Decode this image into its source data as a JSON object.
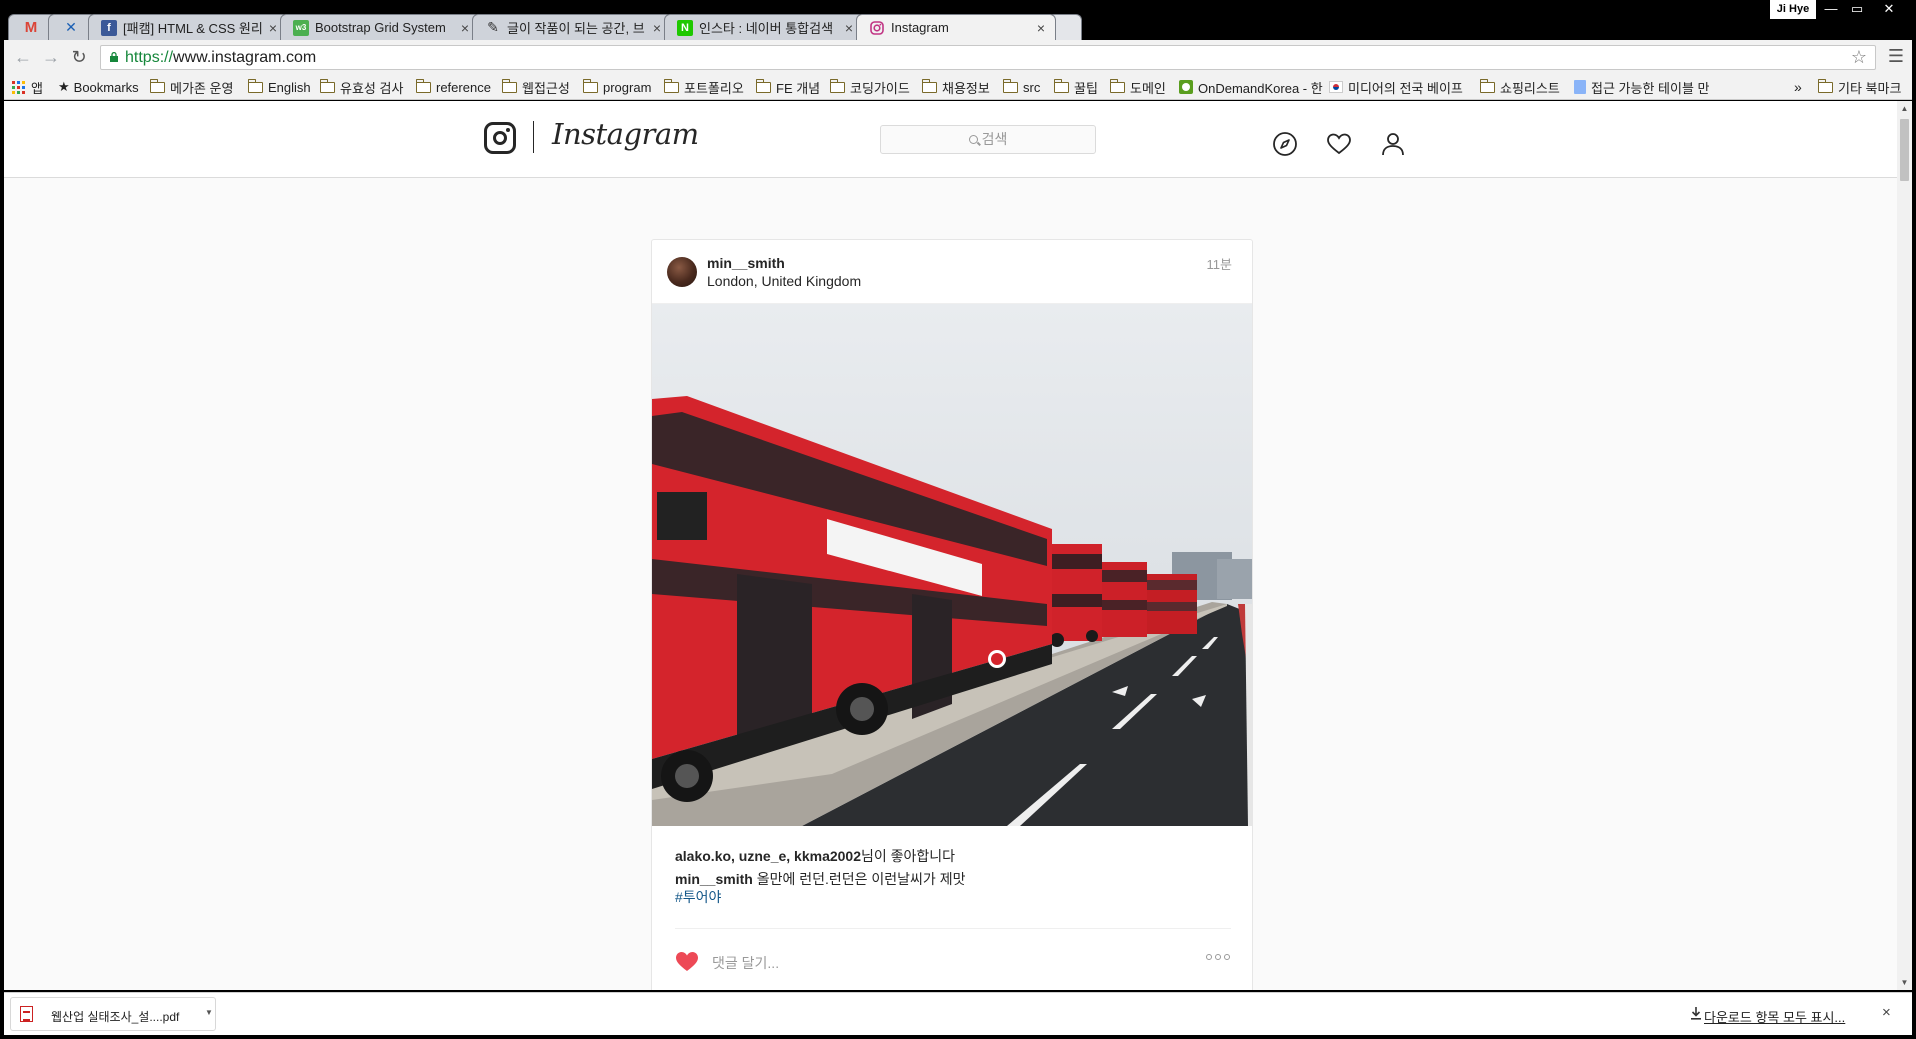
{
  "browser": {
    "profile_name": "Ji Hye",
    "tabs": [
      {
        "label": "",
        "icon": "gmail-icon",
        "color": "#db4437"
      },
      {
        "label": "",
        "icon": "tool-icon",
        "color": "#1a5fb4"
      },
      {
        "label": "[패캠] HTML & CSS 원리",
        "icon": "facebook-icon",
        "color": "#3b5998"
      },
      {
        "label": "Bootstrap Grid System",
        "icon": "w3schools-icon",
        "color": "#4caf50"
      },
      {
        "label": "글이 작품이 되는 공간, 브",
        "icon": "brunch-pen-icon",
        "color": "#333333"
      },
      {
        "label": "인스타 : 네이버 통합검색",
        "icon": "naver-icon",
        "color": "#1ec800"
      },
      {
        "label": "Instagram",
        "icon": "instagram-icon",
        "color": "#c13584"
      }
    ],
    "url": {
      "scheme": "https://",
      "rest": "www.instagram.com"
    },
    "bookmarks": [
      {
        "label": "앱",
        "icon": "apps-grid-icon"
      },
      {
        "label": "Bookmarks",
        "icon": "star-icon"
      },
      {
        "label": "메가존 운영",
        "icon": "folder-icon"
      },
      {
        "label": "English",
        "icon": "folder-icon"
      },
      {
        "label": "유효성 검사",
        "icon": "folder-icon"
      },
      {
        "label": "reference",
        "icon": "folder-icon"
      },
      {
        "label": "웹접근성",
        "icon": "folder-icon"
      },
      {
        "label": "program",
        "icon": "folder-icon"
      },
      {
        "label": "포트폴리오",
        "icon": "folder-icon"
      },
      {
        "label": "FE 개념",
        "icon": "folder-icon"
      },
      {
        "label": "코딩가이드",
        "icon": "folder-icon"
      },
      {
        "label": "채용정보",
        "icon": "folder-icon"
      },
      {
        "label": "src",
        "icon": "folder-icon"
      },
      {
        "label": "꿀팁",
        "icon": "folder-icon"
      },
      {
        "label": "도메인",
        "icon": "folder-icon"
      },
      {
        "label": "OnDemandKorea - 한",
        "icon": "odk-icon"
      },
      {
        "label": "미디어의 전국 베이프",
        "icon": "korea-flag-icon"
      },
      {
        "label": "쇼핑리스트",
        "icon": "folder-icon"
      },
      {
        "label": "접근 가능한 테이블 만",
        "icon": "page-icon"
      }
    ],
    "bookmarks_overflow": "»",
    "other_bookmarks": "기타 북마크"
  },
  "instagram": {
    "wordmark": "Instagram",
    "search_placeholder": "검색",
    "nav_icons": [
      "explore-icon",
      "activity-heart-icon",
      "profile-icon"
    ],
    "post": {
      "username": "min__smith",
      "location": "London, United Kingdom",
      "time_ago": "11분",
      "likers": "alako.ko, uzne_e, kkma2002",
      "likes_suffix": "님이 좋아합니다",
      "caption_user": "min__smith",
      "caption_text": " 올만에 런던.런던은 이런날씨가 제맛",
      "hashtag": "#투어야",
      "comment_placeholder": "댓글 달기...",
      "liked": true,
      "heart_color": "#ed4956"
    }
  },
  "downloads": {
    "file_name": "웹산업 실태조사_설....pdf",
    "show_all": "다운로드 항목 모두 표시...",
    "close": "×"
  }
}
